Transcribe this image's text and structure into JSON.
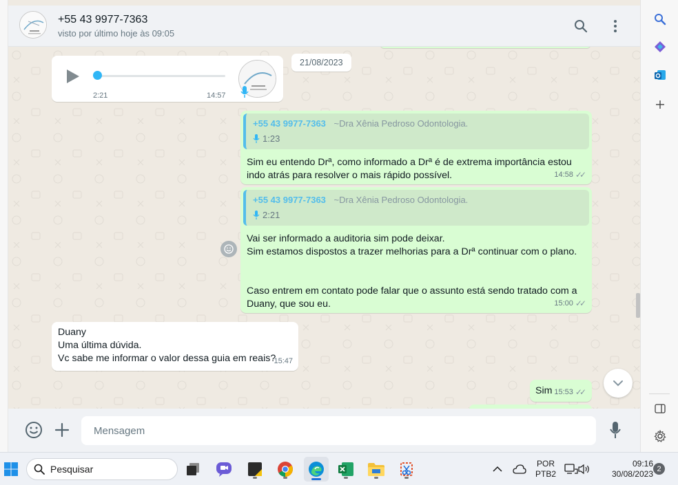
{
  "chat": {
    "contact_name": "+55 43 9977-7363",
    "contact_status": "visto por último hoje às 09:05",
    "date_chip": "21/08/2023",
    "audio": {
      "elapsed": "2:21",
      "time": "14:57",
      "progress": 0.0
    },
    "messages": [
      {
        "quote_phone": "+55 43 9977-7363",
        "quote_author": "~Dra Xênia Pedroso Odontologia.",
        "quote_duration": "1:23",
        "lines": [
          "Sim eu entendo Drª, como informado a Drª é de extrema importância estou",
          "indo atrás para resolver o mais rápido possível."
        ],
        "time": "14:58"
      },
      {
        "quote_phone": "+55 43 9977-7363",
        "quote_author": "~Dra Xênia Pedroso Odontologia.",
        "quote_duration": "2:21",
        "lines": [
          "Vai ser informado a auditoria sim pode deixar.",
          "Sim estamos dispostos a trazer melhorias para a Drª continuar com o plano.",
          "",
          "",
          "Caso entrem em contato pode falar que o assunto está sendo tratado com a",
          "Duany, que sou eu."
        ],
        "time": "15:00"
      },
      {
        "lines": [
          "Duany",
          "Uma última dúvida.",
          "Vc sabe me informar o valor dessa guia em reais?"
        ],
        "time": "15:47"
      },
      {
        "lines": [
          "Sim"
        ],
        "time": "15:53"
      }
    ],
    "composer_placeholder": "Mensagem"
  },
  "taskbar": {
    "search_label": "Pesquisar",
    "language_top": "POR",
    "language_bottom": "PTB2",
    "time": "09:16",
    "date": "30/08/2023",
    "notification_count": "2"
  },
  "colors": {
    "outgoing_bubble": "#d9fdd3",
    "incoming_bubble": "#ffffff",
    "chat_bg": "#efeae2",
    "accent_blue": "#53bdeb"
  }
}
